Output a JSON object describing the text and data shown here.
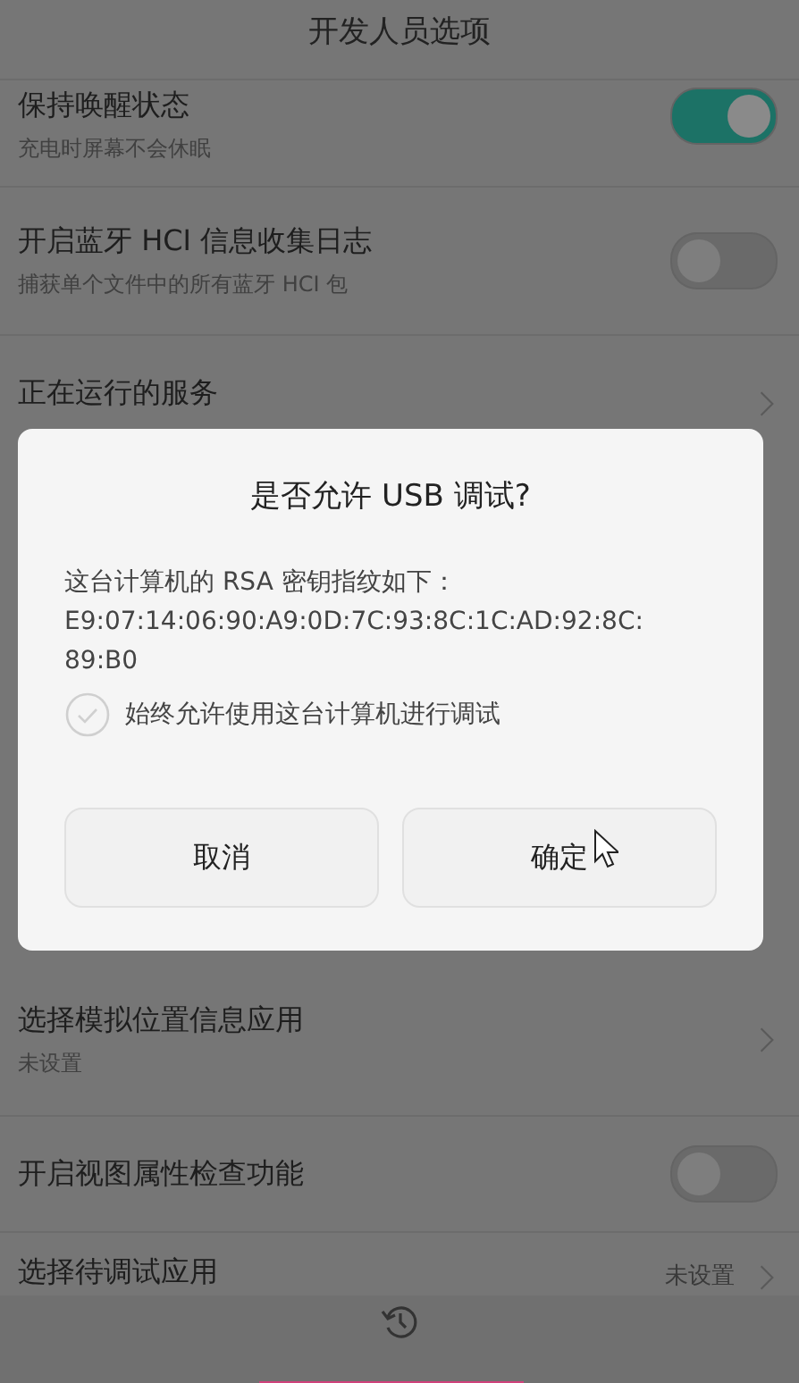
{
  "header": {
    "title": "开发人员选项"
  },
  "settings_top": [
    {
      "kind": "toggle",
      "title": "保持唤醒状态",
      "subtitle": "充电时屏幕不会休眠",
      "on": true
    },
    {
      "kind": "toggle",
      "title": "开启蓝牙 HCI 信息收集日志",
      "subtitle": "捕获单个文件中的所有蓝牙 HCI 包",
      "on": false
    },
    {
      "kind": "link",
      "title": "正在运行的服务"
    }
  ],
  "settings_bottom": [
    {
      "kind": "link",
      "title": "选择模拟位置信息应用",
      "subtitle": "未设置"
    },
    {
      "kind": "toggle",
      "title": "开启视图属性检查功能",
      "on": false
    },
    {
      "kind": "link",
      "title": "选择待调试应用",
      "value": "未设置"
    }
  ],
  "dialog": {
    "title": "是否允许 USB 调试?",
    "message": "这台计算机的 RSA 密钥指纹如下：",
    "fingerprint": "E9:07:14:06:90:A9:0D:7C:93:8C:1C:AD:92:8C:\n89:B0",
    "always_allow": {
      "label": "始终允许使用这台计算机进行调试",
      "checked": false
    },
    "buttons": [
      "取消",
      "确定"
    ]
  }
}
